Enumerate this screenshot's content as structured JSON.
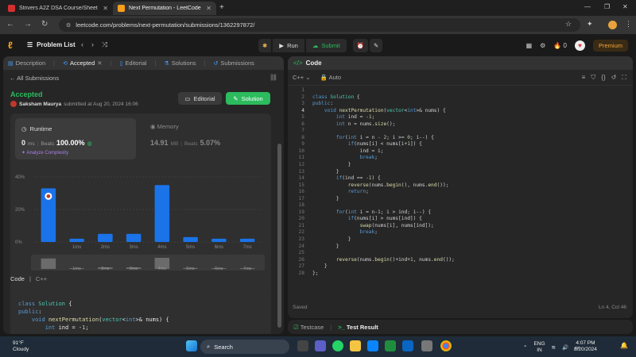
{
  "browser": {
    "tabs": [
      {
        "title": "Strivers A2Z DSA Course/Sheet",
        "active": false
      },
      {
        "title": "Next Permutation - LeetCode",
        "active": true
      }
    ],
    "url": "leetcode.com/problems/next-permutation/submissions/1362297872/"
  },
  "lc_header": {
    "problem_list": "Problem List",
    "run": "Run",
    "submit": "Submit",
    "fire_count": "0",
    "premium": "Premium"
  },
  "left_tabs": [
    {
      "label": "Description"
    },
    {
      "label": "Accepted"
    },
    {
      "label": "Editorial"
    },
    {
      "label": "Solutions"
    },
    {
      "label": "Submissions"
    }
  ],
  "submission": {
    "back_label": "All Submissions",
    "status": "Accepted",
    "user": "Saksham Maurya",
    "submitted_text": "submitted at Aug 20, 2024 16:06",
    "editorial_btn": "Editorial",
    "solution_btn": "Solution"
  },
  "runtime": {
    "label": "Runtime",
    "value": "0",
    "unit": "ms",
    "beats_label": "Beats",
    "beats": "100.00%",
    "analyze": "Analyze Complexity"
  },
  "memory": {
    "label": "Memory",
    "value": "14.91",
    "unit": "MB",
    "beats_label": "Beats",
    "beats": "5.07%"
  },
  "chart_data": {
    "type": "bar",
    "categories": [
      "0ms",
      "1ms",
      "2ms",
      "3ms",
      "4ms",
      "5ms",
      "6ms",
      "7ms"
    ],
    "values": [
      33,
      2,
      5,
      5,
      35,
      3,
      2,
      2
    ],
    "y_ticks": [
      "40%",
      "20%",
      "0%"
    ],
    "ylim": [
      0,
      40
    ],
    "highlight_index": 0,
    "x_tick_labels": [
      "",
      "1ms",
      "2ms",
      "3ms",
      "4ms",
      "5ms",
      "6ms",
      "7ms"
    ],
    "bar_color": "#1a73e8"
  },
  "code_section": {
    "label": "Code",
    "lang": "C++",
    "preview": [
      "class Solution {",
      "public:",
      "    void nextPermutation(vector<int>& nums) {",
      "        int ind = -1;"
    ]
  },
  "editor": {
    "tab_label": "Code",
    "lang": "C++",
    "mode": "Auto",
    "saved": "Saved",
    "cursor": "Ln 4, Col 46",
    "lines": [
      "",
      "class Solution {",
      "public:",
      "    void nextPermutation(vector<int>& nums) {",
      "        int ind = -1;",
      "        int n = nums.size();",
      "",
      "        for(int i = n - 2; i >= 0; i--) {",
      "            if(nums[i] < nums[i+1]) {",
      "                ind = i;",
      "                break;",
      "            }",
      "        }",
      "        if(ind == -1) {",
      "            reverse(nums.begin(), nums.end());",
      "            return;",
      "        }",
      "",
      "        for(int i = n-1; i > ind; i--) {",
      "            if(nums[i] > nums[ind]) {",
      "                swap(nums[i], nums[ind]);",
      "                break;",
      "            }",
      "        }",
      "",
      "        reverse(nums.begin()+ind+1, nums.end());",
      "    }",
      "};"
    ]
  },
  "bottom_tabs": {
    "testcase": "Testcase",
    "result": "Test Result"
  },
  "taskbar": {
    "temp": "91°F",
    "weather": "Cloudy",
    "search": "Search",
    "lang": "ENG",
    "region": "IN",
    "time": "4:07 PM",
    "date": "8/20/2024"
  }
}
